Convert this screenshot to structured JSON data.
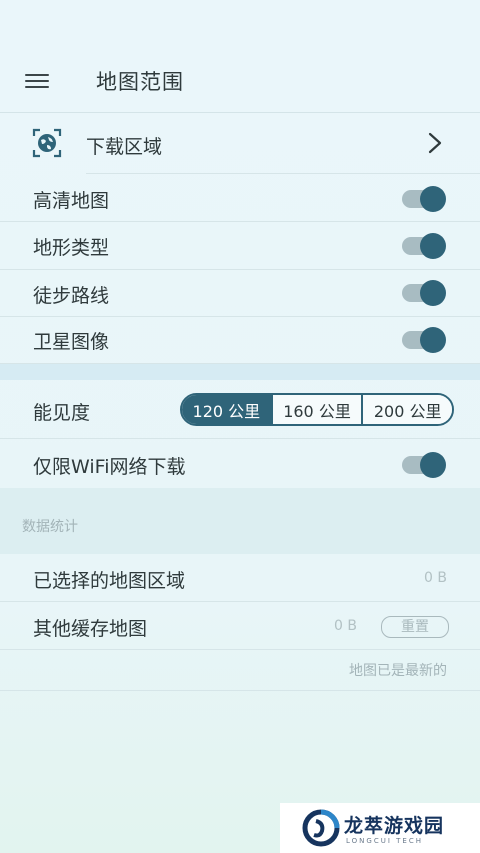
{
  "header": {
    "title": "地图范围",
    "menu_icon": "hamburger-menu-icon"
  },
  "download": {
    "label": "下载区域",
    "icon": "globe-scan-icon",
    "chevron_icon": "chevron-right-icon"
  },
  "layers": [
    {
      "label": "高清地图",
      "enabled": true
    },
    {
      "label": "地形类型",
      "enabled": true
    },
    {
      "label": "徒步路线",
      "enabled": true
    },
    {
      "label": "卫星图像",
      "enabled": true
    }
  ],
  "visibility": {
    "label": "能见度",
    "options": [
      "120 公里",
      "160 公里",
      "200 公里"
    ],
    "selected": "120 公里"
  },
  "wifi_only": {
    "label": "仅限WiFi网络下载",
    "enabled": true
  },
  "stats": {
    "title": "数据统计",
    "selected_regions_label": "已选择的地图区域",
    "selected_regions_value": "0 B",
    "other_cache_label": "其他缓存地图",
    "other_cache_value": "0 B",
    "reset_label": "重置",
    "status_text": "地图已是最新的"
  },
  "watermark": {
    "brand": "龙萃游戏园",
    "sub": "LONGCUI TECH"
  },
  "colors": {
    "accent": "#2f6479",
    "toggle_track": "#a8bcc2",
    "background": "#eaf6fa",
    "muted_text": "#a3b4b8"
  }
}
